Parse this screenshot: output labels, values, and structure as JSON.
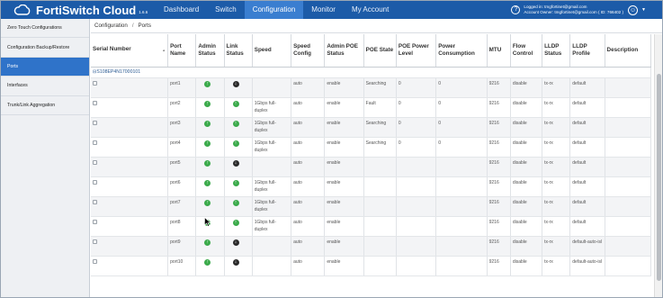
{
  "app": {
    "brand": "FortiSwitch Cloud",
    "version": "1.6.6"
  },
  "nav": {
    "items": [
      {
        "label": "Dashboard",
        "active": false
      },
      {
        "label": "Switch",
        "active": false
      },
      {
        "label": "Configuration",
        "active": true
      },
      {
        "label": "Monitor",
        "active": false
      },
      {
        "label": "My Account",
        "active": false
      }
    ]
  },
  "account": {
    "logged_in": "Logged in: tmgfortinet@gmail.com",
    "owner": "Account Owner: tmgfortinet@gmail.com ( ID: 766402 )"
  },
  "sidebar": {
    "items": [
      {
        "label": "Zero Touch Configurations",
        "active": false
      },
      {
        "label": "Configuration Backup/Restore",
        "active": false
      },
      {
        "label": "Ports",
        "active": true
      },
      {
        "label": "Interfaces",
        "active": false
      },
      {
        "label": "Trunk/Link Aggregation",
        "active": false
      }
    ]
  },
  "breadcrumb": {
    "parent": "Configuration",
    "separator": "/",
    "current": "Ports"
  },
  "table": {
    "headers": [
      "Serial Number",
      "Port Name",
      "Admin Status",
      "Link Status",
      "Speed",
      "Speed Config",
      "Admin POE Status",
      "POE State",
      "POE Power Level",
      "Power Consumption",
      "MTU",
      "Flow Control",
      "LLDP Status",
      "LLDP Profile",
      "Description"
    ],
    "group_label": "S108EP4N17000101",
    "rows": [
      {
        "port": "port1",
        "admin": "up",
        "link": "down",
        "speed": "",
        "speed_config": "auto",
        "admin_poe": "enable",
        "poe_state": "Searching",
        "poe_level": "0",
        "power": "0",
        "mtu": "9216",
        "flow": "disable",
        "lldp_status": "tx-rx",
        "lldp_profile": "default",
        "description": ""
      },
      {
        "port": "port2",
        "admin": "up",
        "link": "up",
        "speed": "1Gbps full-duplex",
        "speed_config": "auto",
        "admin_poe": "enable",
        "poe_state": "Fault",
        "poe_level": "0",
        "power": "0",
        "mtu": "9216",
        "flow": "disable",
        "lldp_status": "tx-rx",
        "lldp_profile": "default",
        "description": ""
      },
      {
        "port": "port3",
        "admin": "up",
        "link": "up",
        "speed": "1Gbps full-duplex",
        "speed_config": "auto",
        "admin_poe": "enable",
        "poe_state": "Searching",
        "poe_level": "0",
        "power": "0",
        "mtu": "9216",
        "flow": "disable",
        "lldp_status": "tx-rx",
        "lldp_profile": "default",
        "description": ""
      },
      {
        "port": "port4",
        "admin": "up",
        "link": "up",
        "speed": "1Gbps full-duplex",
        "speed_config": "auto",
        "admin_poe": "enable",
        "poe_state": "Searching",
        "poe_level": "0",
        "power": "0",
        "mtu": "9216",
        "flow": "disable",
        "lldp_status": "tx-rx",
        "lldp_profile": "default",
        "description": ""
      },
      {
        "port": "port5",
        "admin": "up",
        "link": "down",
        "speed": "",
        "speed_config": "auto",
        "admin_poe": "enable",
        "poe_state": "",
        "poe_level": "",
        "power": "",
        "mtu": "9216",
        "flow": "disable",
        "lldp_status": "tx-rx",
        "lldp_profile": "default",
        "description": ""
      },
      {
        "port": "port6",
        "admin": "up",
        "link": "up",
        "speed": "1Gbps full-duplex",
        "speed_config": "auto",
        "admin_poe": "enable",
        "poe_state": "",
        "poe_level": "",
        "power": "",
        "mtu": "9216",
        "flow": "disable",
        "lldp_status": "tx-rx",
        "lldp_profile": "default",
        "description": ""
      },
      {
        "port": "port7",
        "admin": "up",
        "link": "up",
        "speed": "1Gbps full-duplex",
        "speed_config": "auto",
        "admin_poe": "enable",
        "poe_state": "",
        "poe_level": "",
        "power": "",
        "mtu": "9216",
        "flow": "disable",
        "lldp_status": "tx-rx",
        "lldp_profile": "default",
        "description": ""
      },
      {
        "port": "port8",
        "admin": "up",
        "link": "up",
        "speed": "1Gbps full-duplex",
        "speed_config": "auto",
        "admin_poe": "enable",
        "poe_state": "",
        "poe_level": "",
        "power": "",
        "mtu": "9216",
        "flow": "disable",
        "lldp_status": "tx-rx",
        "lldp_profile": "default",
        "description": ""
      },
      {
        "port": "port9",
        "admin": "up",
        "link": "down",
        "speed": "",
        "speed_config": "auto",
        "admin_poe": "enable",
        "poe_state": "",
        "poe_level": "",
        "power": "",
        "mtu": "9216",
        "flow": "disable",
        "lldp_status": "tx-rx",
        "lldp_profile": "default-auto-isl",
        "description": ""
      },
      {
        "port": "port10",
        "admin": "up",
        "link": "down",
        "speed": "",
        "speed_config": "auto",
        "admin_poe": "enable",
        "poe_state": "",
        "poe_level": "",
        "power": "",
        "mtu": "9216",
        "flow": "disable",
        "lldp_status": "tx-rx",
        "lldp_profile": "default-auto-isl",
        "description": ""
      }
    ]
  },
  "colors": {
    "topbar": "#1c5ba8",
    "nav_active": "#3a7ed0",
    "sidebar_active": "#2f73c9",
    "status_up": "#3aaa4a",
    "status_down": "#2a2a2a"
  },
  "icons": {
    "logo": "cloud-icon",
    "help": "question-icon",
    "user": "user-circle-icon",
    "status_up": "arrow-up-circle-icon",
    "status_down": "arrow-down-circle-icon",
    "collapse": "minus-box-icon"
  }
}
